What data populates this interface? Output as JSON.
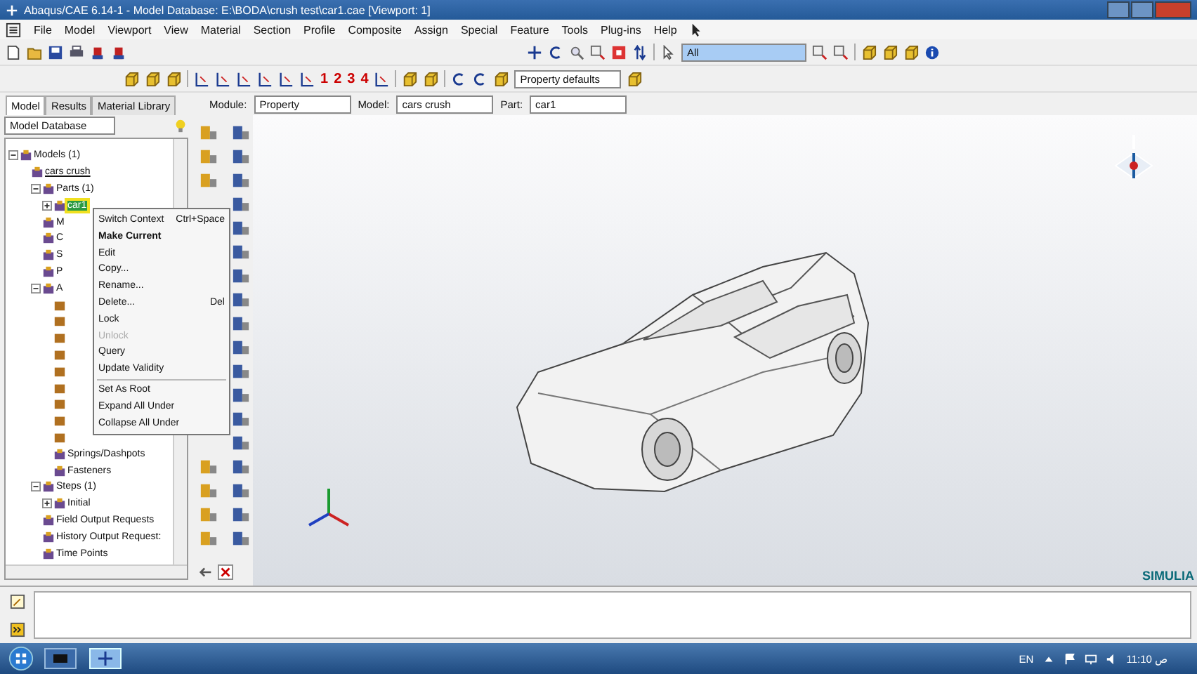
{
  "window": {
    "title": "Abaqus/CAE 6.14-1 - Model Database: E:\\BODA\\crush test\\car1.cae [Viewport: 1]"
  },
  "menu_bar": [
    "File",
    "Model",
    "Viewport",
    "View",
    "Material",
    "Section",
    "Profile",
    "Composite",
    "Assign",
    "Special",
    "Feature",
    "Tools",
    "Plug-ins",
    "Help"
  ],
  "toolbar": {
    "selection_filter": "All",
    "view_numbers": [
      "1",
      "2",
      "3",
      "4"
    ],
    "color_code": "Property defaults"
  },
  "tabs": [
    {
      "label": "Model",
      "selected": true
    },
    {
      "label": "Results",
      "selected": false
    },
    {
      "label": "Material Library",
      "selected": false
    }
  ],
  "context_bar": {
    "module_label": "Module:",
    "module": "Property",
    "model_label": "Model:",
    "model": "cars crush",
    "part_label": "Part:",
    "part": "car1"
  },
  "tree": {
    "selector": "Model Database",
    "items": [
      {
        "label": "Models (1)",
        "expanded": true,
        "children": [
          {
            "label": "cars crush",
            "link": true,
            "children": [
              {
                "label": "Parts (1)",
                "expanded": true,
                "children": [
                  {
                    "label": "car1",
                    "expanded": false,
                    "selected": true
                  }
                ]
              },
              {
                "label": "M"
              },
              {
                "label": "C"
              },
              {
                "label": "S"
              },
              {
                "label": "P"
              },
              {
                "label": "A",
                "expanded": true,
                "children": [
                  {
                    "kind": "covered"
                  },
                  {
                    "kind": "covered"
                  },
                  {
                    "kind": "covered"
                  },
                  {
                    "kind": "covered"
                  },
                  {
                    "kind": "covered"
                  },
                  {
                    "kind": "covered"
                  },
                  {
                    "kind": "covered"
                  },
                  {
                    "kind": "covered"
                  },
                  {
                    "kind": "covered"
                  },
                  {
                    "label": "Springs/Dashpots"
                  },
                  {
                    "label": "Fasteners"
                  }
                ]
              },
              {
                "label": "Steps (1)",
                "expanded": true,
                "children": [
                  {
                    "label": "Initial",
                    "expanded": false
                  }
                ]
              },
              {
                "label": "Field Output Requests"
              },
              {
                "label": "History Output Request:"
              },
              {
                "label": "Time Points"
              }
            ]
          }
        ]
      }
    ]
  },
  "context_menu": {
    "items": [
      {
        "kind": "item",
        "label": "Switch Context",
        "shortcut": "Ctrl+Space"
      },
      {
        "kind": "item",
        "label": "Make Current",
        "bold": true
      },
      {
        "kind": "item",
        "label": "Edit"
      },
      {
        "kind": "item",
        "label": "Copy..."
      },
      {
        "kind": "item",
        "label": "Rename..."
      },
      {
        "kind": "item",
        "label": "Delete...",
        "shortcut": "Del"
      },
      {
        "kind": "item",
        "label": "Lock"
      },
      {
        "kind": "item",
        "label": "Unlock",
        "disabled": true
      },
      {
        "kind": "item",
        "label": "Query"
      },
      {
        "kind": "item",
        "label": "Update Validity"
      },
      {
        "kind": "separator"
      },
      {
        "kind": "item",
        "label": "Set As Root"
      },
      {
        "kind": "item",
        "label": "Expand All Under"
      },
      {
        "kind": "item",
        "label": "Collapse All Under"
      }
    ]
  },
  "brand": "SIMULIA",
  "taskbar": {
    "language": "EN",
    "time": "11:10 ص"
  }
}
